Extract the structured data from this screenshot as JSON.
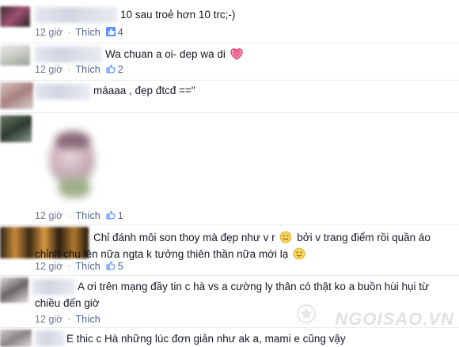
{
  "comments": [
    {
      "text": "10 sau troẻ hơn 10 trc;-)",
      "time": "12 giờ",
      "like_label": "Thích",
      "likes": "4"
    },
    {
      "text": "Wa chuan a oi- dep wa di",
      "time": "12 giờ",
      "like_label": "Thích",
      "likes": "2",
      "emoji": "heart-icon"
    },
    {
      "text": "máaaa , đẹp đtcđ ==\"",
      "time": "",
      "like_label": "",
      "likes": ""
    },
    {
      "text": "",
      "time": "12 giờ",
      "like_label": "Thích",
      "likes": "1"
    },
    {
      "text_line1": "Chỉ đánh môi son thoy mà đẹp như v r",
      "text_line1b": "bởi v trang điểm rồi quần áo",
      "text_line2": "chỉnh chu lên nữa ngta k tưởng thiên thần nữa mới lạ",
      "time": "12 giờ",
      "like_label": "Thích",
      "likes": "5",
      "emoji": "smile-emoji-icon"
    },
    {
      "text_line1": "A ơi trên mạng đầy tin c hà vs a cường ly thân có thật ko a buồn hùi hụi từ",
      "text_line2": "chiều đến giờ",
      "time": "12 giờ",
      "like_label": "Thích",
      "likes": ""
    },
    {
      "text": "E thic c Hà những lúc đơn giản như ak a, mami e cũng vậy"
    }
  ],
  "separator": "·",
  "watermark": "NGOISAO.VN",
  "colors": {
    "link": "#4e5f8c",
    "meta": "#6d7992",
    "text": "#141823",
    "heart": "#e0245e"
  }
}
